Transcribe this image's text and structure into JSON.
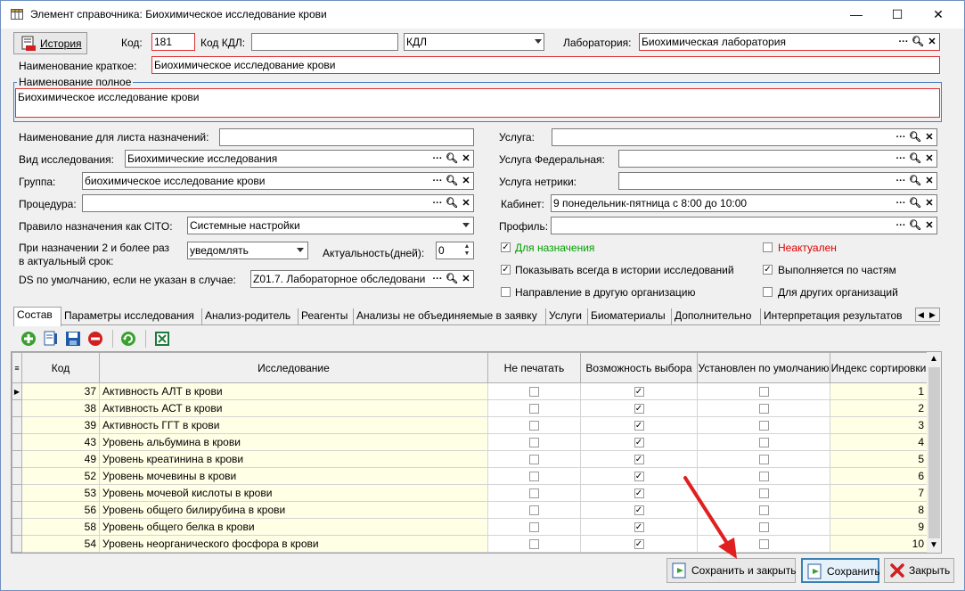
{
  "window": {
    "title": "Элемент справочника: Биохимическое исследование крови",
    "controls": [
      "—",
      "☐",
      "✕"
    ]
  },
  "header": {
    "history_button": "История",
    "code_label": "Код:",
    "code_value": "181",
    "kdl_code_label": "Код КДЛ:",
    "kdl_code_value": "",
    "kdl_select_value": "КДЛ",
    "lab_label": "Лаборатория:",
    "lab_value": "Биохимическая лаборатория",
    "short_name_label": "Наименование краткое:",
    "short_name_value": "Биохимическое исследование крови",
    "full_name_legend": "Наименование полное",
    "full_name_value": "Биохимическое исследование крови"
  },
  "left_fields": {
    "assign_sheet_label": "Наименование для листа назначений:",
    "assign_sheet_value": "",
    "study_type_label": "Вид исследования:",
    "study_type_value": "Биохимические исследования",
    "group_label": "Группа:",
    "group_value": "биохимическое исследование крови",
    "procedure_label": "Процедура:",
    "procedure_value": "",
    "cito_label": "Правило назначения как CITO:",
    "cito_value": "Системные настройки",
    "repeat_label_1": "При назначении 2 и более раз",
    "repeat_label_2": "в актуальный срок:",
    "repeat_value": "уведомлять",
    "actuality_label": "Актуальность(дней):",
    "actuality_value": "0",
    "ds_label": "DS по умолчанию, если не указан в случае:",
    "ds_value": "Z01.7. Лабораторное обследовани"
  },
  "right_fields": {
    "service_label": "Услуга:",
    "service_value": "",
    "federal_label": "Услуга Федеральная:",
    "federal_value": "",
    "netrika_label": "Услуга нетрики:",
    "netrika_value": "",
    "cabinet_label": "Кабинет:",
    "cabinet_value": "9 понедельник-пятница с 8:00 до 10:00",
    "profile_label": "Профиль:",
    "profile_value": ""
  },
  "checkboxes": {
    "for_assign": "Для назначения",
    "not_actual": "Неактуален",
    "show_history": "Показывать всегда в истории исследований",
    "by_parts": "Выполняется по частям",
    "other_org_direction": "Направление в другую организацию",
    "for_other_orgs": "Для других организаций"
  },
  "tabs": [
    "Состав",
    "Параметры исследования",
    "Анализ-родитель",
    "Реагенты",
    "Анализы не объединяемые в заявку",
    "Услуги",
    "Биоматериалы",
    "Дополнительно",
    "Интерпретация результатов"
  ],
  "table": {
    "columns": [
      "Код",
      "Исследование",
      "Не печатать",
      "Возможность выбора",
      "Установлен по умолчанию",
      "Индекс сортировки"
    ],
    "rows": [
      {
        "code": "37",
        "name": "Активность АЛТ в крови",
        "no_print": false,
        "selectable": true,
        "default": false,
        "sort": "1"
      },
      {
        "code": "38",
        "name": "Активность АСТ в крови",
        "no_print": false,
        "selectable": true,
        "default": false,
        "sort": "2"
      },
      {
        "code": "39",
        "name": "Активность ГГТ в крови",
        "no_print": false,
        "selectable": true,
        "default": false,
        "sort": "3"
      },
      {
        "code": "43",
        "name": "Уровень альбумина в крови",
        "no_print": false,
        "selectable": true,
        "default": false,
        "sort": "4"
      },
      {
        "code": "49",
        "name": "Уровень креатинина в крови",
        "no_print": false,
        "selectable": true,
        "default": false,
        "sort": "5"
      },
      {
        "code": "52",
        "name": "Уровень мочевины в крови",
        "no_print": false,
        "selectable": true,
        "default": false,
        "sort": "6"
      },
      {
        "code": "53",
        "name": "Уровень мочевой кислоты в крови",
        "no_print": false,
        "selectable": true,
        "default": false,
        "sort": "7"
      },
      {
        "code": "56",
        "name": "Уровень общего билирубина в крови",
        "no_print": false,
        "selectable": true,
        "default": false,
        "sort": "8"
      },
      {
        "code": "58",
        "name": "Уровень общего белка в крови",
        "no_print": false,
        "selectable": true,
        "default": false,
        "sort": "9"
      },
      {
        "code": "54",
        "name": "Уровень неорганического фосфора в крови",
        "no_print": false,
        "selectable": true,
        "default": false,
        "sort": "10"
      }
    ]
  },
  "footer": {
    "save_close": "Сохранить и закрыть",
    "save": "Сохранить",
    "close": "Закрыть"
  },
  "colors": {
    "required_border": "#e03030",
    "green_label": "#00a000",
    "red_label": "#e00000",
    "row_bg": "#ffffe6",
    "annotation_arrow": "#e02020"
  }
}
